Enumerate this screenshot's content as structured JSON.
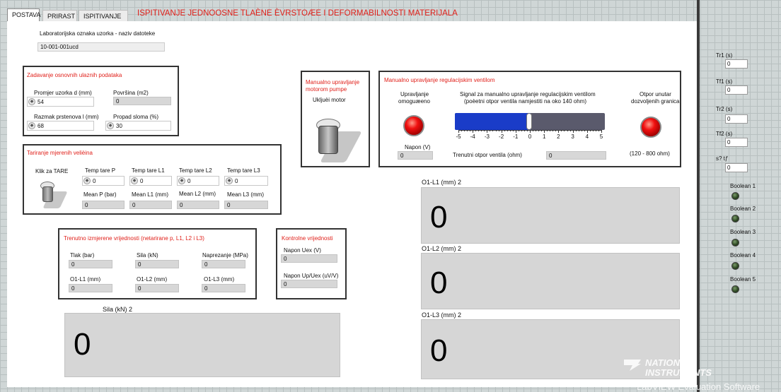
{
  "tabs": [
    "POSTAVA",
    "PRIRAST",
    "ISPITIVANJE"
  ],
  "title": "ISPITIVANJE JEDNOOSNE TLAČNE ČVRSTOĆE I DEFORMABILNOSTI MATERIJALA",
  "title_raw": "ISPITIVANJE JEDNOOSNE TLAÈNE ÈVRSTOÆE I DEFORMABILNOSTI MATERIJALA",
  "sample": {
    "label": "Laboratorijska oznaka uzorka - naziv datoteke",
    "value": "10-001-001ucd"
  },
  "input": {
    "title": "Zadavanje osnovnih ulaznih podataka",
    "diameter_label": "Promjer uzorka d (mm)",
    "diameter_value": "54",
    "area_label": "Površina (m2)",
    "area_value": "0",
    "ring_label": "Razmak prstenova l (mm)",
    "ring_value": "68",
    "drop_label": "Propad sloma (%)",
    "drop_value": "30"
  },
  "tare": {
    "title": "Tariranje mjerenih velièina",
    "button_label": "Klik za TARE",
    "temp_p_label": "Temp tare P",
    "temp_p": "0",
    "temp_l1_label": "Temp tare L1",
    "temp_l1": "0",
    "temp_l2_label": "Temp tare L2",
    "temp_l2": "0",
    "temp_l3_label": "Temp tare L3",
    "temp_l3": "0",
    "mean_p_label": "Mean P (bar)",
    "mean_p": "0",
    "mean_l1_label": "Mean L1 (mm)",
    "mean_l1": "0",
    "mean_l2_label": "Mean L2 (mm)",
    "mean_l2": "0",
    "mean_l3_label": "Mean L3 (mm)",
    "mean_l3": "0"
  },
  "pump": {
    "title_line1": "Manualno upravljanje",
    "title_line2": "motorom pumpe",
    "switch_label": "Ukljuèi motor"
  },
  "valve": {
    "title": "Manualno upravljanje regulacijskim ventilom",
    "enable_line1": "Upravljanje",
    "enable_line2": "omoguæeno",
    "signal_line1": "Signal za manualno upravljanje regulacijskim ventilom",
    "signal_line2": "(poèetni otpor ventila namjestiti na oko 140 ohm)",
    "resist_line1": "Otpor unutar",
    "resist_line2": "dozvoljenih granica",
    "voltage_label": "Napon (V)",
    "voltage_value": "0",
    "current_label": "Trenutni otpor ventila (ohm)",
    "current_value": "0",
    "range_label": "(120 - 800 ohm)",
    "slider_ticks": [
      "-5",
      "-4",
      "-3",
      "-2",
      "-1",
      "0",
      "1",
      "2",
      "3",
      "4",
      "5"
    ],
    "slider_value": 0.5
  },
  "measured": {
    "title": "Trenutno izmjerene vrijednosti (netarirane p, L1, L2 i L3)",
    "tlak_label": "Tlak (bar)",
    "tlak": "0",
    "sila_label": "Sila (kN)",
    "sila": "0",
    "napr_label": "Naprezanje (MPa)",
    "napr": "0",
    "o1l1_label": "O1-L1 (mm)",
    "o1l1": "0",
    "o1l2_label": "O1-L2 (mm)",
    "o1l2": "0",
    "o1l3_label": "O1-L3 (mm)",
    "o1l3": "0"
  },
  "control": {
    "title": "Kontrolne vrijednosti",
    "uex_label": "Napon Uex (V)",
    "uex": "0",
    "upuex_label": "Napon Up/Uex (uV/V)",
    "upuex": "0"
  },
  "big": {
    "sila_label": "Sila (kN) 2",
    "sila": "0",
    "l1_label": "O1-L1 (mm) 2",
    "l1": "0",
    "l2_label": "O1-L2 (mm) 2",
    "l2": "0",
    "l3_label": "O1-L3 (mm) 2",
    "l3": "0"
  },
  "side": {
    "tr1_label": "Tr1 (s)",
    "tr1": "0",
    "tf1_label": "Tf1 (s)",
    "tf1": "0",
    "tr2_label": "Tr2 (s)",
    "tr2": "0",
    "tf2_label": "Tf2 (s)",
    "tf2": "0",
    "stf_label": "s? tƒ",
    "stf": "0",
    "booleans": [
      "Boolean 1",
      "Boolean 2",
      "Boolean 3",
      "Boolean 4",
      "Boolean 5"
    ]
  },
  "watermark": {
    "line1": "NATIONAL",
    "line2": "INSTRUMENTS",
    "line3": "LabVIEW Evaluation Software"
  },
  "colors": {
    "title_red": "#e0201a",
    "slider_blue": "#1a3cc8",
    "led_red": "#f01010",
    "led_green": "#2e4a24"
  }
}
